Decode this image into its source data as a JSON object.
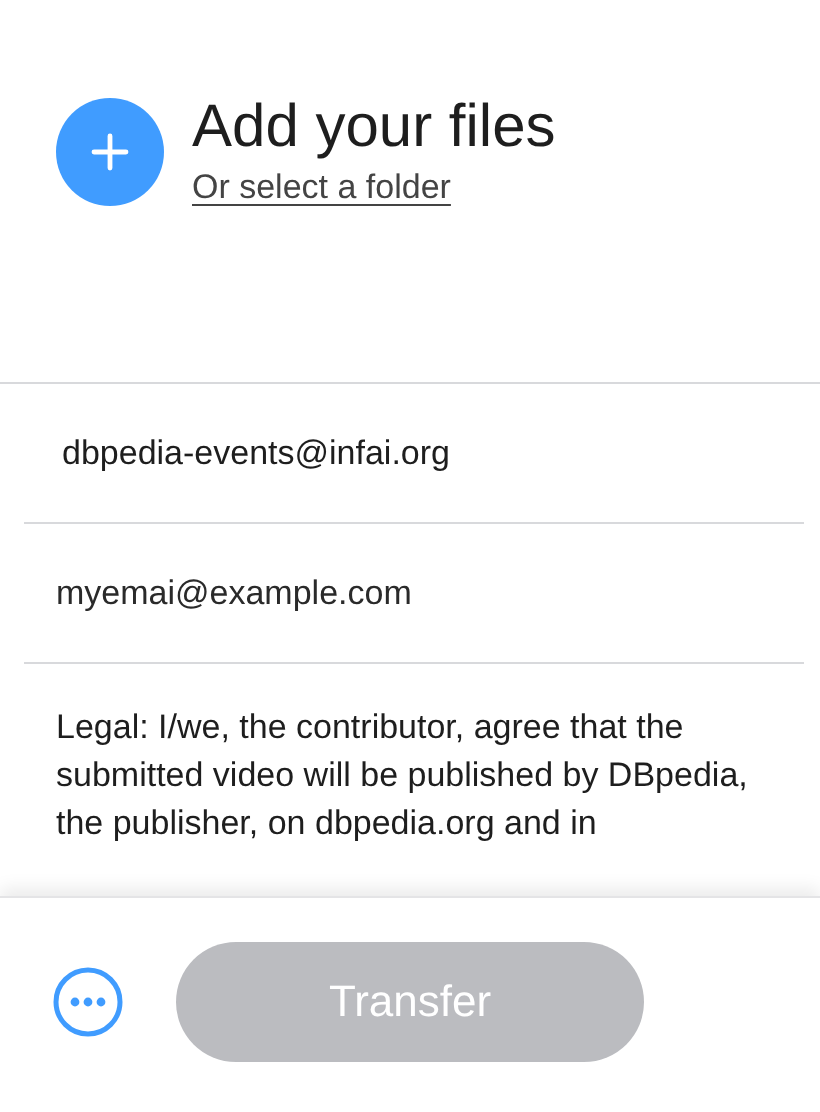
{
  "upload": {
    "title": "Add your files",
    "folder_link": "Or select a folder"
  },
  "fields": [
    {
      "kind": "recipient",
      "value": "dbpedia-events@infai.org"
    },
    {
      "kind": "email",
      "value": "myemai@example.com"
    }
  ],
  "legal": "Legal: I/we, the contributor, agree that the submitted video will be published by DBpedia, the publisher, on dbpedia.org and in",
  "footer": {
    "transfer": {
      "label": "Transfer",
      "disabled": true
    }
  }
}
